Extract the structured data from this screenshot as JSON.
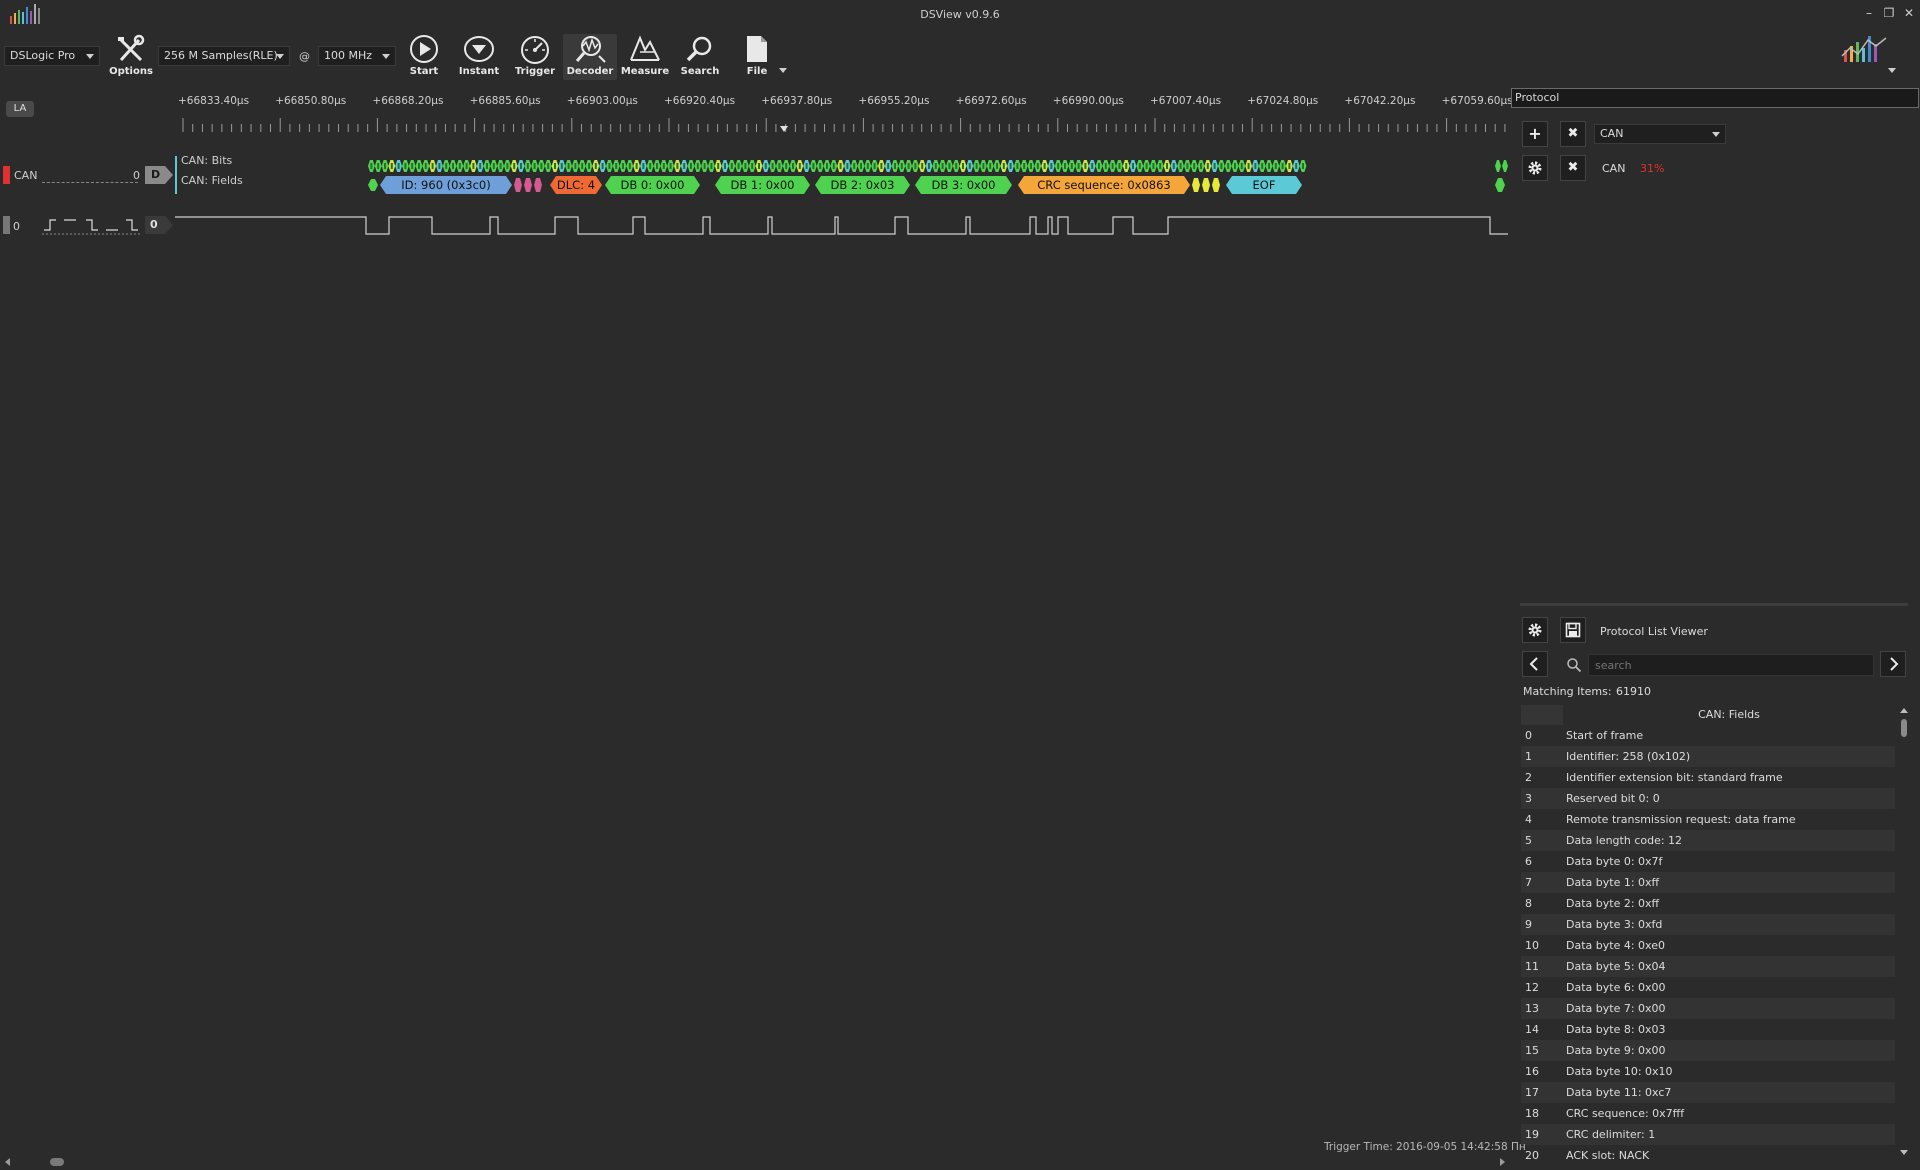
{
  "window": {
    "title": "DSView v0.9.6",
    "minimize_glyph": "–",
    "restore_glyph": "❐",
    "close_glyph": "✕"
  },
  "toolbar": {
    "device": "DSLogic Pro",
    "samples": "256 M Samples(RLE)",
    "at": "@",
    "rate": "100 MHz",
    "buttons": {
      "options": "Options",
      "start": "Start",
      "instant": "Instant",
      "trigger": "Trigger",
      "decoder": "Decoder",
      "measure": "Measure",
      "search": "Search",
      "file": "File"
    }
  },
  "ruler": {
    "labels": [
      "+66833.40µs",
      "+66850.80µs",
      "+66868.20µs",
      "+66885.60µs",
      "+66903.00µs",
      "+66920.40µs",
      "+66937.80µs",
      "+66955.20µs",
      "+66972.60µs",
      "+66990.00µs",
      "+67007.40µs",
      "+67024.80µs",
      "+67042.20µs",
      "+67059.60µs"
    ]
  },
  "signals": {
    "la_badge": "LA",
    "decoder_channel": "CAN",
    "decoder_value": "0",
    "decoder_tag": "D",
    "row_bits": "CAN: Bits",
    "row_fields": "CAN: Fields",
    "logic_channel": "0",
    "logic_value": "0",
    "fields": [
      {
        "text": "ID: 960 (0x3c0)",
        "color": "#6f9fd8"
      },
      {
        "text": "DLC: 4",
        "color": "#ee6a32"
      },
      {
        "text": "DB 0: 0x00",
        "color": "#4fd24f"
      },
      {
        "text": "DB 1: 0x00",
        "color": "#4fd24f"
      },
      {
        "text": "DB 2: 0x03",
        "color": "#4fd24f"
      },
      {
        "text": "DB 3: 0x00",
        "color": "#4fd24f"
      },
      {
        "text": "CRC sequence: 0x0863",
        "color": "#f5a63a"
      },
      {
        "text": "EOF",
        "color": "#5cc9d6"
      }
    ]
  },
  "protocol_panel": {
    "input_value": "Protocol",
    "add_glyph": "+",
    "remove_glyph": "✖",
    "select_value": "CAN",
    "decoder_name": "CAN",
    "decoder_progress": "31%",
    "progress_color": "#e03030"
  },
  "list_viewer": {
    "title": "Protocol List Viewer",
    "search_placeholder": "search",
    "matching_label": "Matching Items:",
    "matching_count": "61910",
    "column_header": "CAN: Fields",
    "rows": [
      {
        "index": "0",
        "text": "Start of frame"
      },
      {
        "index": "1",
        "text": "Identifier: 258 (0x102)"
      },
      {
        "index": "2",
        "text": "Identifier extension bit: standard frame"
      },
      {
        "index": "3",
        "text": "Reserved bit 0: 0"
      },
      {
        "index": "4",
        "text": "Remote transmission request: data frame"
      },
      {
        "index": "5",
        "text": "Data length code: 12"
      },
      {
        "index": "6",
        "text": "Data byte 0: 0x7f"
      },
      {
        "index": "7",
        "text": "Data byte 1: 0xff"
      },
      {
        "index": "8",
        "text": "Data byte 2: 0xff"
      },
      {
        "index": "9",
        "text": "Data byte 3: 0xfd"
      },
      {
        "index": "10",
        "text": "Data byte 4: 0xe0"
      },
      {
        "index": "11",
        "text": "Data byte 5: 0x04"
      },
      {
        "index": "12",
        "text": "Data byte 6: 0x00"
      },
      {
        "index": "13",
        "text": "Data byte 7: 0x00"
      },
      {
        "index": "14",
        "text": "Data byte 8: 0x03"
      },
      {
        "index": "15",
        "text": "Data byte 9: 0x00"
      },
      {
        "index": "16",
        "text": "Data byte 10: 0x10"
      },
      {
        "index": "17",
        "text": "Data byte 11: 0xc7"
      },
      {
        "index": "18",
        "text": "CRC sequence: 0x7fff"
      },
      {
        "index": "19",
        "text": "CRC delimiter: 1"
      },
      {
        "index": "20",
        "text": "ACK slot: NACK"
      }
    ]
  },
  "status": {
    "trigger_time": "Trigger Time: 2016-09-05 14:42:58 Пн"
  }
}
